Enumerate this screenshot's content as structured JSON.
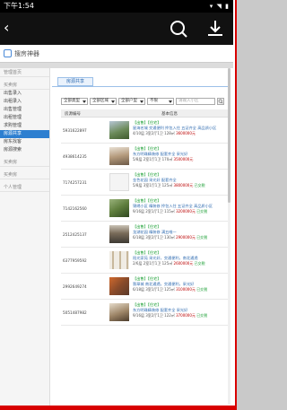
{
  "status_bar": {
    "time": "下午1:54",
    "icons_text": "▾ ◥ ▮"
  },
  "app_bar": {
    "back_glyph": "‹"
  },
  "site": {
    "logo_text": "搜房神器"
  },
  "sidebar": {
    "sections": [
      {
        "label": "管理首页",
        "items": []
      },
      {
        "label": "买卖房",
        "items": [
          "出售录入",
          "出租录入",
          "出售管理",
          "出租管理",
          "求购管理",
          "房源共享",
          "房东找客",
          "房源搜索"
        ],
        "active_index": 5
      },
      {
        "label": "买卖房",
        "items": []
      },
      {
        "label": "买卖房",
        "items": []
      },
      {
        "label": "个人管理",
        "items": []
      }
    ]
  },
  "main": {
    "tab_label": "房源共享",
    "filters": [
      {
        "label": "全部类型"
      },
      {
        "label": "全部区域"
      },
      {
        "label": "全部户型"
      },
      {
        "label": "不限"
      }
    ],
    "search_placeholder": "请输入小区",
    "table": {
      "headers": [
        "房源编号",
        "基本信息"
      ],
      "rows": [
        {
          "id": "5931622897",
          "tag": "【出售】【住宅】",
          "title": "星海名城 交通便利 拎包入住 五证齐全 高品质小区",
          "meta1": "4/10层 3室2厅1卫 128㎡",
          "price": "3600000元",
          "extra": ""
        },
        {
          "id": "4938614235",
          "tag": "【出售】【住宅】",
          "title": "东方明珠精装修 配套齐全 采光好",
          "meta1": "5/8层 2室1厅1卫 170㎡",
          "price": "3500000元",
          "extra": ""
        },
        {
          "id": "7174257231",
          "tag": "【出售】【住宅】",
          "title": "金色花园 采光好 配套齐全",
          "meta1": "5/8层 3室1厅1卫 125㎡",
          "price": "3800000元",
          "extra": "已交税"
        },
        {
          "id": "7142162560",
          "tag": "【出售】【住宅】",
          "title": "锦绣小区 精装修 拎包入住 五证齐全 高品质小区",
          "meta1": "9/16层 2室1厅1卫 115㎡",
          "price": "3200000元",
          "extra": "已交税"
        },
        {
          "id": "2512425137",
          "tag": "【出售】【住宅】",
          "title": "龙湖花园 精装修 满五唯一",
          "meta1": "6/18层 3室2厅1卫 130㎡",
          "price": "2900000元",
          "extra": "已交税"
        },
        {
          "id": "6377959592",
          "tag": "【出售】【住宅】",
          "title": "阳光家苑 采光好，交通便利，南北通透",
          "meta1": "2/6层 2室1厅1卫 125㎡",
          "price": "2600000元",
          "extra": "已交税"
        },
        {
          "id": "2992649274",
          "tag": "【出售】【住宅】",
          "title": "翡翠城 南北通透，交通便利，采光好",
          "meta1": "6/18层 3室1厅1卫 125㎡",
          "price": "3100000元",
          "extra": "已交税"
        },
        {
          "id": "5051487982",
          "tag": "【出售】【住宅】",
          "title": "东方明珠精装修 配套齐全 采光好",
          "meta1": "9/16层 3室2厅1卫 122㎡",
          "price": "3700000元",
          "extra": "已交税"
        }
      ]
    }
  },
  "colors": {
    "accent": "#2d7fd0",
    "frame": "#d80000",
    "appbar": "#111111"
  }
}
